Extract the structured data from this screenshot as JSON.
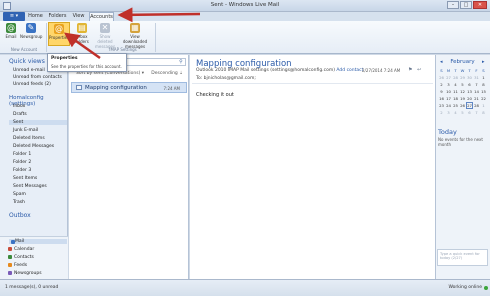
{
  "window": {
    "title": "Sent - Windows Live Mail",
    "minimize_glyph": "–",
    "maximize_glyph": "□",
    "close_glyph": "✕"
  },
  "ribbon": {
    "file_tab_glyph": "≡ ▾",
    "tabs": [
      "Home",
      "Folders",
      "View",
      "Accounts"
    ],
    "buttons": {
      "email": "Email",
      "newsgroup": "Newsgroup",
      "properties": "Properties",
      "inbox_folders": "Inbox folders",
      "show_deleted": "Show deleted messages",
      "view_downloaded": "View downloaded messages"
    },
    "groups": {
      "new_account": "New Account",
      "imap_settings": "IMAP Settings"
    }
  },
  "tooltip": {
    "title": "Properties",
    "description": "See the properties for this account."
  },
  "folders": {
    "quick_views_heading": "Quick views",
    "quick_views": [
      "Unread e-mail",
      "Unread from contacts",
      "Unread feeds (2)"
    ],
    "account_heading": "Homalconfig (settings)",
    "account_folders": [
      "Inbox",
      "Drafts",
      "Sent",
      "Junk E-mail",
      "Deleted Items",
      "Deleted Messages",
      "Folder 1",
      "Folder 2",
      "Folder 3",
      "Sent Items",
      "Sent Messages",
      "Spam",
      "Trash"
    ],
    "selected_folder": "Sent",
    "outbox_heading": "Outbox"
  },
  "nav": {
    "items": [
      "Mail",
      "Calendar",
      "Contacts",
      "Feeds",
      "Newsgroups"
    ],
    "selected": "Mail"
  },
  "message_list": {
    "search_placeholder": "",
    "sort_by": "Sort by sent (Conversations) ▾",
    "sort_direction": "Descending ⇣",
    "messages": [
      {
        "subject": "Mapping configuration",
        "date": "7:24 AM"
      }
    ]
  },
  "reading": {
    "subject": "Mapping configuration",
    "from": "Outlook 2010 IMAP Mail settings (settings@homalconfig.com)",
    "add_contact": "Add contact",
    "to": "To: bjnicholas@gmail.com;",
    "date": "2/27/2014 7:24 AM",
    "body": "Checking it out"
  },
  "calendar": {
    "month": "February",
    "prev": "◂",
    "next": "▸",
    "weekday_headers": [
      "S",
      "M",
      "T",
      "W",
      "T",
      "F",
      "S"
    ],
    "weeks": [
      [
        "26",
        "27",
        "28",
        "29",
        "30",
        "31",
        "1"
      ],
      [
        "2",
        "3",
        "4",
        "5",
        "6",
        "7",
        "8"
      ],
      [
        "9",
        "10",
        "11",
        "12",
        "13",
        "14",
        "15"
      ],
      [
        "16",
        "17",
        "18",
        "19",
        "20",
        "21",
        "22"
      ],
      [
        "23",
        "24",
        "25",
        "26",
        "27",
        "28",
        "1"
      ],
      [
        "2",
        "3",
        "4",
        "5",
        "6",
        "7",
        "8"
      ]
    ],
    "today_heading": "Today",
    "today_text": "No events for the next month",
    "quick_event_placeholder": "Type a quick event for today (2/27)"
  },
  "status": {
    "left": "1 message(s), 0 unread",
    "right": "Working online"
  },
  "colors": {
    "accent": "#2a5aa8",
    "annotation_arrow": "#c0302a"
  }
}
